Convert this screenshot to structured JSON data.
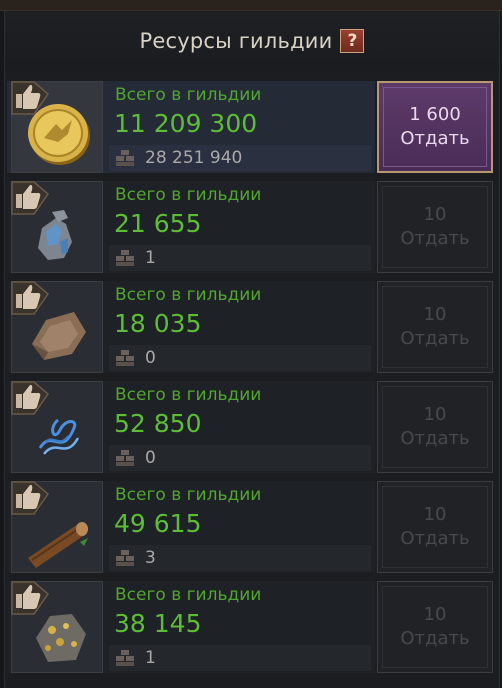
{
  "header": {
    "title": "Ресурсы гильдии",
    "help_label": "?"
  },
  "resources": [
    {
      "label": "Всего в гильдии",
      "amount": "11 209 300",
      "personal": "28 251 940",
      "cost": "1 600",
      "action": "Отдать",
      "icon": "gold-coin-icon",
      "active": true
    },
    {
      "label": "Всего в гильдии",
      "amount": "21 655",
      "personal": "1",
      "cost": "10",
      "action": "Отдать",
      "icon": "iron-ore-icon",
      "active": false
    },
    {
      "label": "Всего в гильдии",
      "amount": "18 035",
      "personal": "0",
      "cost": "10",
      "action": "Отдать",
      "icon": "leather-hide-icon",
      "active": false
    },
    {
      "label": "Всего в гильдии",
      "amount": "52 850",
      "personal": "0",
      "cost": "10",
      "action": "Отдать",
      "icon": "blue-thread-icon",
      "active": false
    },
    {
      "label": "Всего в гильдии",
      "amount": "49 615",
      "personal": "3",
      "cost": "10",
      "action": "Отдать",
      "icon": "wood-log-icon",
      "active": false
    },
    {
      "label": "Всего в гильдии",
      "amount": "38 145",
      "personal": "1",
      "cost": "10",
      "action": "Отдать",
      "icon": "gold-ore-icon",
      "active": false
    }
  ],
  "colors": {
    "amount_green": "#5dbd35",
    "active_button": "#5d3a6a",
    "active_row": "#252a37"
  }
}
